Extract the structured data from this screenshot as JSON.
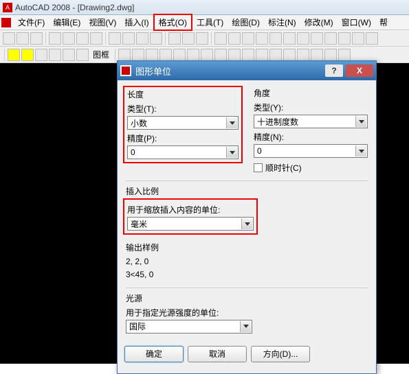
{
  "app": {
    "title": "AutoCAD 2008 - [Drawing2.dwg]"
  },
  "menus": {
    "file": "文件(F)",
    "edit": "编辑(E)",
    "view": "视图(V)",
    "insert": "插入(I)",
    "format": "格式(O)",
    "tool": "工具(T)",
    "draw": "绘图(D)",
    "dim": "标注(N)",
    "modify": "修改(M)",
    "window": "窗口(W)",
    "help": "帮"
  },
  "toolbar2": {
    "frame": "图框"
  },
  "dialog": {
    "title": "图形单位",
    "length": {
      "title": "长度",
      "type_label": "类型(T):",
      "type_value": "小数",
      "precision_label": "精度(P):",
      "precision_value": "0"
    },
    "angle": {
      "title": "角度",
      "type_label": "类型(Y):",
      "type_value": "十进制度数",
      "precision_label": "精度(N):",
      "precision_value": "0",
      "clockwise": "顺时针(C)"
    },
    "insert": {
      "title": "插入比例",
      "label": "用于缩放插入内容的单位:",
      "value": "毫米"
    },
    "sample": {
      "title": "输出样例",
      "line1": "2, 2, 0",
      "line2": "3<45, 0"
    },
    "light": {
      "title": "光源",
      "label": "用于指定光源强度的单位:",
      "value": "国际"
    },
    "buttons": {
      "ok": "确定",
      "cancel": "取消",
      "direction": "方向(D)..."
    }
  }
}
